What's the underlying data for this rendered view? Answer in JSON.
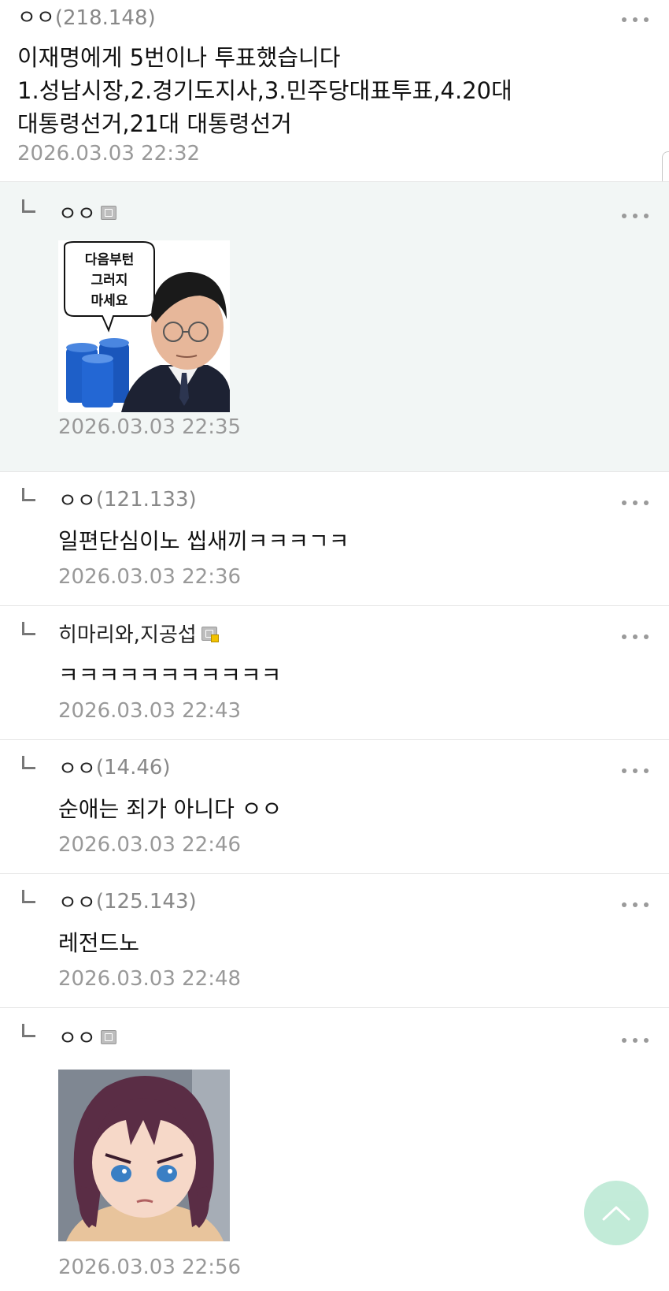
{
  "post": {
    "nick": "ㅇㅇ",
    "ip": "(218.148)",
    "lines": [
      "이재명에게 5번이나 투표했습니다",
      "1.성남시장,2.경기도지사,3.민주당대표투표,4.20대",
      "대통령선거,21대 대통령선거"
    ],
    "date": "2026.03.03 22:32"
  },
  "replies": [
    {
      "nick": "ㅇㅇ",
      "ip": "",
      "badge": "gray",
      "text": "",
      "date": "2026.03.03 22:35",
      "image": {
        "caption_lines": [
          "다음부턴",
          "그러지",
          "마세요"
        ]
      }
    },
    {
      "nick": "ㅇㅇ",
      "ip": "(121.133)",
      "text": "일편단심이노 씹새끼ㅋㅋㅋㄱㅋ",
      "date": "2026.03.03 22:36"
    },
    {
      "nick": "히마리와,지공섭",
      "ip": "",
      "badge": "gold",
      "text": "ㅋㅋㅋㅋㅋㅋㅋㅋㅋㅋㅋ",
      "date": "2026.03.03 22:43"
    },
    {
      "nick": "ㅇㅇ",
      "ip": "(14.46)",
      "text": "순애는 죄가 아니다 ㅇㅇ",
      "date": "2026.03.03 22:46"
    },
    {
      "nick": "ㅇㅇ",
      "ip": "(125.143)",
      "text": "레전드노",
      "date": "2026.03.03 22:48"
    },
    {
      "nick": "ㅇㅇ",
      "ip": "",
      "badge": "gray",
      "text": "",
      "date": "2026.03.03 22:56"
    }
  ],
  "colors": {
    "highlight": "#f2f6f5",
    "fab": "#b8e8d2",
    "muted": "#999999"
  },
  "icons": {
    "more": "more-dots-icon",
    "reply": "reply-arrow-icon",
    "top": "chevron-up-icon"
  }
}
